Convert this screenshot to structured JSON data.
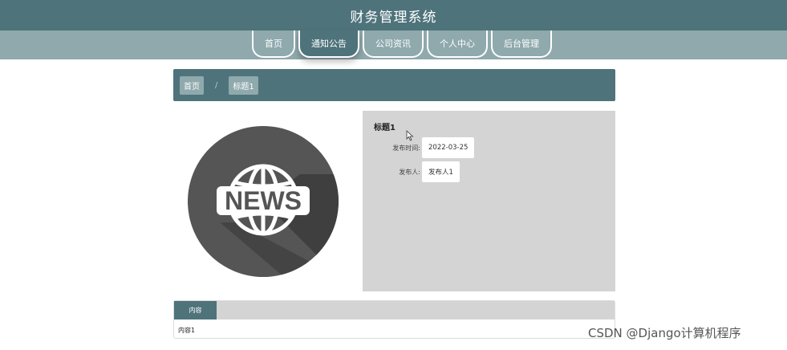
{
  "header": {
    "title": "财务管理系统"
  },
  "nav": {
    "items": [
      {
        "label": "首页"
      },
      {
        "label": "通知公告"
      },
      {
        "label": "公司资讯"
      },
      {
        "label": "个人中心"
      },
      {
        "label": "后台管理"
      }
    ],
    "active_index": 1
  },
  "breadcrumb": {
    "home": "首页",
    "separator": "/",
    "current": "标题1"
  },
  "news_image": {
    "text": "NEWS",
    "icon": "globe-icon"
  },
  "detail": {
    "title": "标题1",
    "publish_time_label": "发布时间:",
    "publish_time_value": "2022-03-25",
    "publisher_label": "发布人:",
    "publisher_value": "发布人1"
  },
  "content": {
    "tab_label": "内容",
    "text": "内容1"
  },
  "watermark": "CSDN @Django计算机程序",
  "colors": {
    "primary": "#4e737b",
    "nav_strip": "#8fa9ad",
    "panel": "#d4d4d4"
  }
}
